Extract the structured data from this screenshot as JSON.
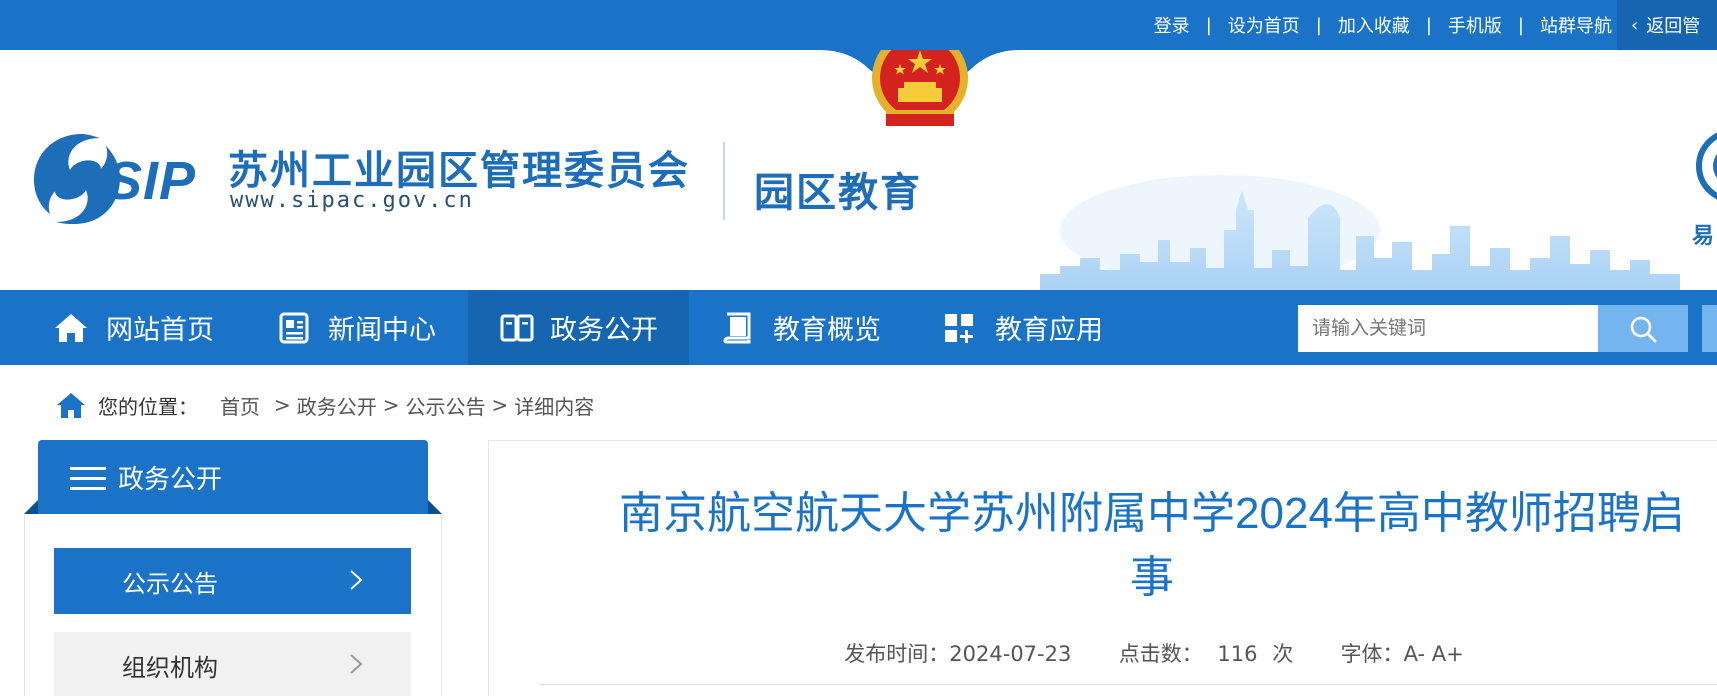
{
  "topbar": {
    "links": [
      "登录",
      "设为首页",
      "加入收藏",
      "手机版",
      "站群导航"
    ],
    "separator": "|",
    "return_label": "返回管"
  },
  "header": {
    "site_name": "苏州工业园区管理委员会",
    "site_url": "www.sipac.gov.cn",
    "logo_text": "SIP",
    "sub_site": "园区教育",
    "right_logo_text": "易"
  },
  "nav": {
    "items": [
      {
        "label": "网站首页",
        "icon": "home-icon"
      },
      {
        "label": "新闻中心",
        "icon": "newspaper-icon"
      },
      {
        "label": "政务公开",
        "icon": "book-open-icon"
      },
      {
        "label": "教育概览",
        "icon": "book-icon"
      },
      {
        "label": "教育应用",
        "icon": "grid-plus-icon"
      }
    ],
    "active_index": 2,
    "search_placeholder": "请输入关键词"
  },
  "breadcrumb": {
    "label": "您的位置：",
    "items": [
      "首页",
      "政务公开",
      "公示公告",
      "详细内容"
    ],
    "separator": ">"
  },
  "sidebar": {
    "title": "政务公开",
    "items": [
      {
        "label": "公示公告",
        "active": true
      },
      {
        "label": "组织机构",
        "active": false
      }
    ]
  },
  "article": {
    "title_line1": "南京航空航天大学苏州附属中学2024年高中教师招聘启",
    "title_line2": "事",
    "publish_label": "发布时间：",
    "publish_date": "2024-07-23",
    "clicks_label": "点击数：",
    "clicks_value": "116",
    "clicks_unit": "次",
    "font_label": "字体：",
    "font_smaller": "A-",
    "font_larger": "A+"
  },
  "colors": {
    "primary": "#1a73c6",
    "primary_dark": "#1565b0",
    "search_button": "#74b4ef",
    "title": "#1a73c6"
  }
}
